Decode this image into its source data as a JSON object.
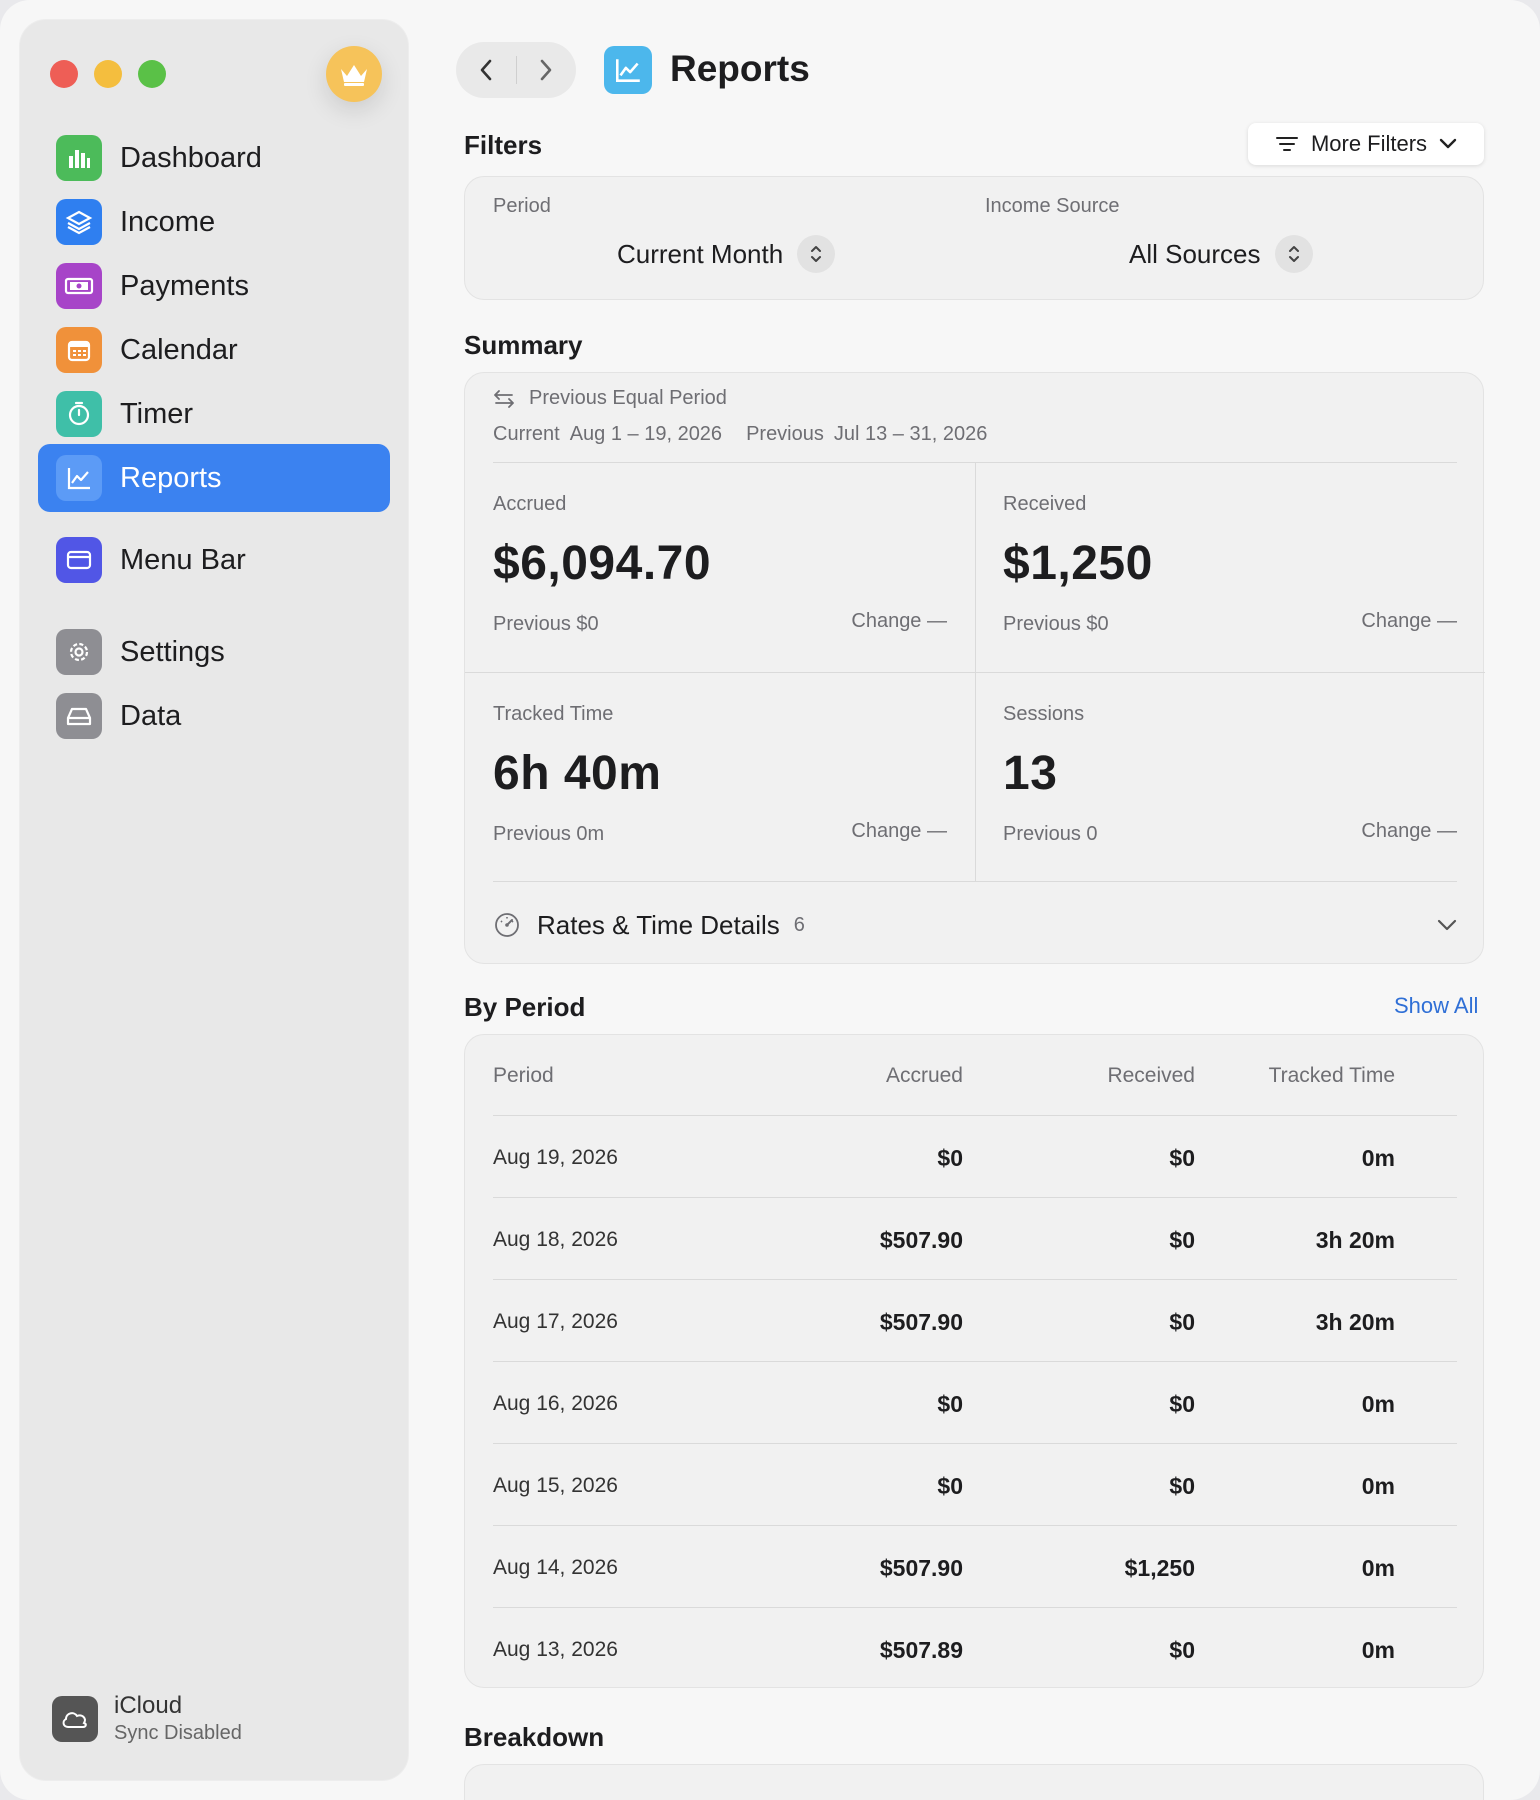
{
  "window": {
    "title": "Reports"
  },
  "sidebar": {
    "items": [
      {
        "label": "Dashboard",
        "icon": "chart-bar-icon",
        "color": "#4cbb5a"
      },
      {
        "label": "Income",
        "icon": "stack-icon",
        "color": "#2f7ff0"
      },
      {
        "label": "Payments",
        "icon": "banknote-icon",
        "color": "#a744c8"
      },
      {
        "label": "Calendar",
        "icon": "calendar-icon",
        "color": "#f0913a"
      },
      {
        "label": "Timer",
        "icon": "timer-icon",
        "color": "#3fbfa8"
      },
      {
        "label": "Reports",
        "icon": "chart-line-icon",
        "color": "#4d93f5",
        "active": true
      },
      {
        "label": "Menu Bar",
        "icon": "window-icon",
        "color": "#5156e6"
      },
      {
        "label": "Settings",
        "icon": "gear-icon",
        "color": "#8e8e93"
      },
      {
        "label": "Data",
        "icon": "drive-icon",
        "color": "#8e8e93"
      }
    ],
    "icloud": {
      "title": "iCloud",
      "status": "Sync Disabled"
    }
  },
  "filters": {
    "heading": "Filters",
    "more_filters": "More Filters",
    "period_label": "Period",
    "period_value": "Current Month",
    "source_label": "Income Source",
    "source_value": "All Sources"
  },
  "summary": {
    "heading": "Summary",
    "comparison": "Previous Equal Period",
    "current_label": "Current",
    "current_range": "Aug 1 – 19, 2026",
    "previous_label": "Previous",
    "previous_range": "Jul 13 – 31, 2026",
    "metrics": {
      "accrued": {
        "label": "Accrued",
        "value": "$6,094.70",
        "previous": "Previous $0",
        "change": "Change —"
      },
      "received": {
        "label": "Received",
        "value": "$1,250",
        "previous": "Previous $0",
        "change": "Change —"
      },
      "tracked": {
        "label": "Tracked Time",
        "value": "6h 40m",
        "previous": "Previous 0m",
        "change": "Change —"
      },
      "sessions": {
        "label": "Sessions",
        "value": "13",
        "previous": "Previous 0",
        "change": "Change —"
      }
    },
    "details_label": "Rates & Time Details",
    "details_count": "6"
  },
  "by_period": {
    "heading": "By Period",
    "show_all": "Show All",
    "columns": [
      "Period",
      "Accrued",
      "Received",
      "Tracked Time"
    ],
    "rows": [
      [
        "Aug 19, 2026",
        "$0",
        "$0",
        "0m"
      ],
      [
        "Aug 18, 2026",
        "$507.90",
        "$0",
        "3h 20m"
      ],
      [
        "Aug 17, 2026",
        "$507.90",
        "$0",
        "3h 20m"
      ],
      [
        "Aug 16, 2026",
        "$0",
        "$0",
        "0m"
      ],
      [
        "Aug 15, 2026",
        "$0",
        "$0",
        "0m"
      ],
      [
        "Aug 14, 2026",
        "$507.90",
        "$1,250",
        "0m"
      ],
      [
        "Aug 13, 2026",
        "$507.89",
        "$0",
        "0m"
      ]
    ]
  },
  "breakdown": {
    "heading": "Breakdown"
  }
}
